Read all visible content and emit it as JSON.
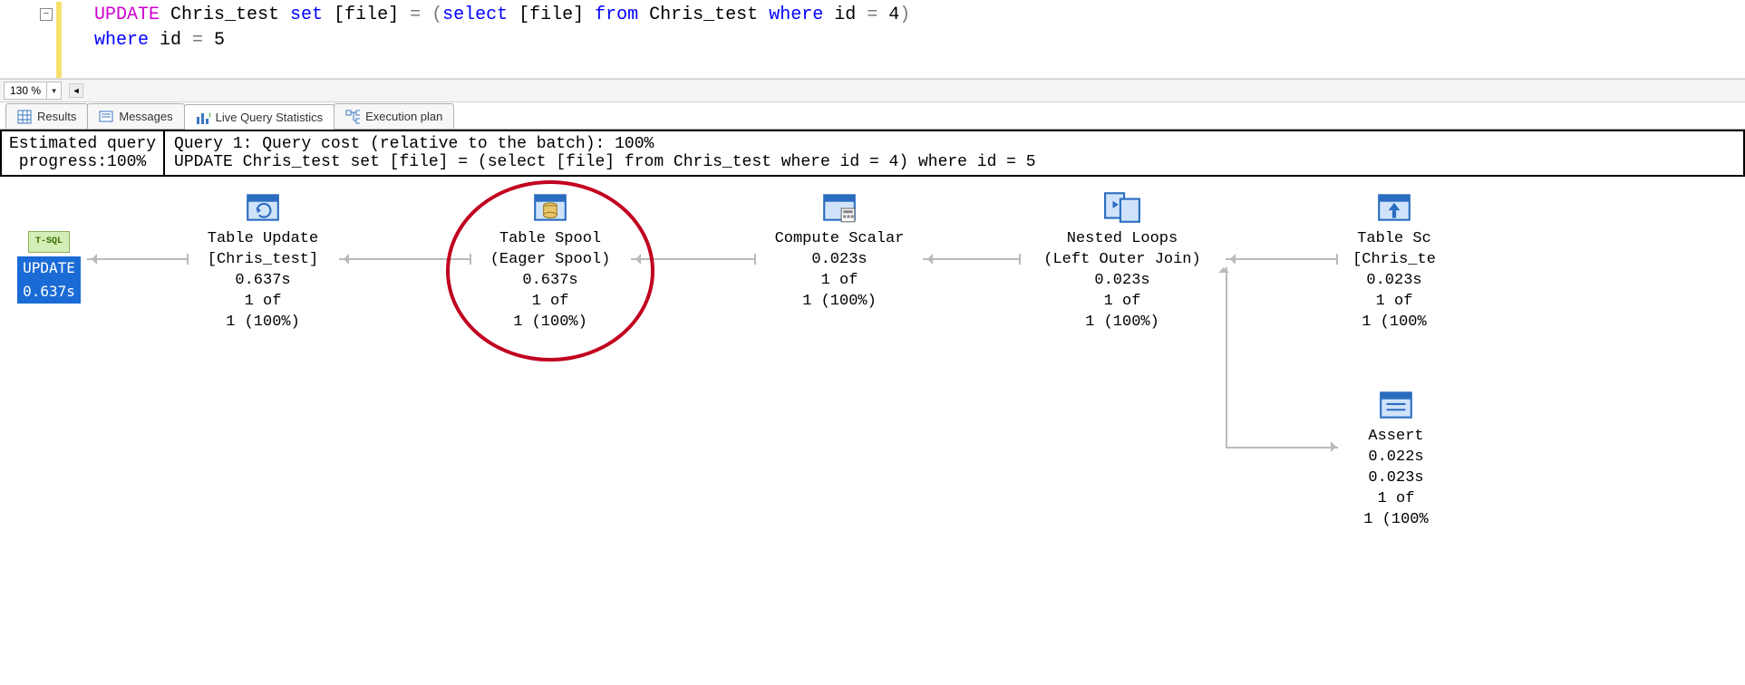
{
  "editor": {
    "line1": {
      "update": "UPDATE",
      "table1": " Chris_test ",
      "set": "set",
      "file1": " [file] ",
      "eq1": "=",
      "paren1": " (",
      "select": "select",
      "file2": " [file] ",
      "from": "from",
      "table2": " Chris_test ",
      "where1": "where",
      "idexpr1": " id ",
      "eq2": "=",
      "num1": " 4",
      "paren2": ")"
    },
    "line2": {
      "where": "where",
      "idexpr": " id ",
      "eq": "=",
      "num": " 5"
    }
  },
  "zoom": {
    "value": "130 %"
  },
  "tabs": {
    "results": "Results",
    "messages": "Messages",
    "live": "Live Query Statistics",
    "plan": "Execution plan"
  },
  "stats": {
    "left_line1": "Estimated query",
    "left_line2": " progress:100% ",
    "right_line1": "Query 1: Query cost (relative to the batch): 100%",
    "right_line2": "UPDATE Chris_test set [file] = (select [file] from Chris_test where id = 4) where id = 5"
  },
  "plan": {
    "root": {
      "tsql": "T-SQL",
      "label": "UPDATE",
      "time": "0.637s"
    },
    "nodes": [
      {
        "id": "update",
        "title": "Table Update",
        "sub": "[Chris_test]",
        "time": "0.637s",
        "rows1": "1 of",
        "rows2": "1 (100%)"
      },
      {
        "id": "spool",
        "title": "Table Spool",
        "sub": "(Eager Spool)",
        "time": "0.637s",
        "rows1": "1 of",
        "rows2": "1 (100%)"
      },
      {
        "id": "compute",
        "title": "Compute Scalar",
        "sub": "",
        "time": "0.023s",
        "rows1": "1 of",
        "rows2": "1 (100%)"
      },
      {
        "id": "loops",
        "title": "Nested Loops",
        "sub": "(Left Outer Join)",
        "time": "0.023s",
        "rows1": "1 of",
        "rows2": "1 (100%)"
      },
      {
        "id": "scan",
        "title": "Table Sc",
        "sub": "[Chris_te",
        "time": "0.023s",
        "rows1": "1 of",
        "rows2": "1 (100%"
      },
      {
        "id": "assert",
        "title": "Assert",
        "sub": "",
        "time": "0.022s",
        "rows3": "0.023s",
        "rows1": "1 of",
        "rows2": "1 (100%"
      }
    ]
  }
}
